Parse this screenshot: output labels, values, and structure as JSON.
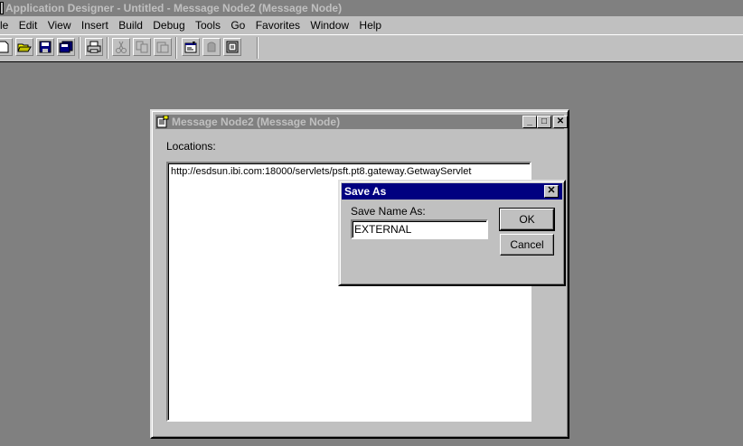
{
  "app": {
    "title": "Application Designer - Untitled - Message Node2 (Message Node)"
  },
  "menu": {
    "items": [
      "le",
      "Edit",
      "View",
      "Insert",
      "Build",
      "Debug",
      "Tools",
      "Go",
      "Favorites",
      "Window",
      "Help"
    ]
  },
  "toolbar": {
    "buttons": [
      {
        "icon": "new-icon",
        "enabled": true
      },
      {
        "icon": "open-folder-icon",
        "enabled": true
      },
      {
        "icon": "save-icon",
        "enabled": true
      },
      {
        "icon": "save-all-icon",
        "enabled": true
      },
      {
        "icon": "print-icon",
        "enabled": true
      },
      {
        "icon": "cut-icon",
        "enabled": false
      },
      {
        "icon": "copy-icon",
        "enabled": false
      },
      {
        "icon": "paste-icon",
        "enabled": false
      },
      {
        "icon": "properties-icon",
        "enabled": true
      },
      {
        "icon": "build-icon",
        "enabled": false
      },
      {
        "icon": "project-icon",
        "enabled": true
      }
    ]
  },
  "child_window": {
    "title": "Message Node2 (Message Node)",
    "locations_label": "Locations:",
    "locations": [
      "http://esdsun.ibi.com:18000/servlets/psft.pt8.gateway.GetwayServlet"
    ]
  },
  "save_as_dialog": {
    "title": "Save As",
    "name_label": "Save Name As:",
    "name_value": "EXTERNAL",
    "ok_label": "OK",
    "cancel_label": "Cancel"
  },
  "colors": {
    "desktop": "#808080",
    "active_title": "#000080",
    "inactive_title": "#808080",
    "face": "#c0c0c0"
  }
}
